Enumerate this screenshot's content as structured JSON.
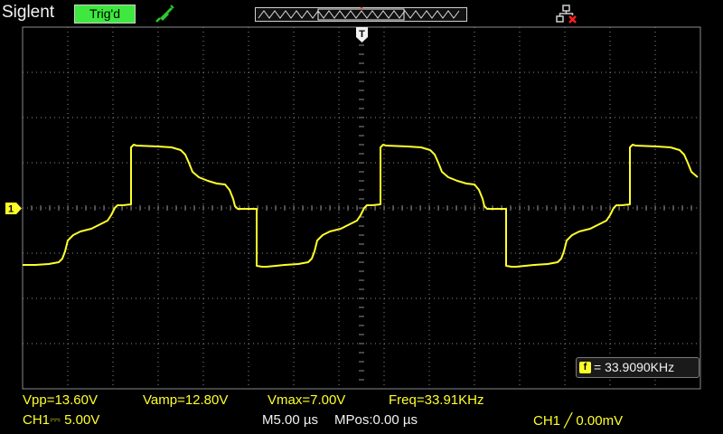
{
  "header": {
    "brand": "Siglent",
    "trigger_status": "Trig'd"
  },
  "icons": {
    "probe": "probe-icon",
    "network": "network-disconnected-icon",
    "trigger_marker": "trigger-position-icon",
    "channel_marker": "ch1-ground-marker-icon"
  },
  "colors": {
    "trace": "#ffff2a",
    "trigger_status_bg": "#3ee83e",
    "grid": "#8a8a8a"
  },
  "markers": {
    "trigger": "T",
    "channel": "1"
  },
  "freq_counter": {
    "icon_label": "f",
    "value": "= 33.9090KHz"
  },
  "measurements": {
    "vpp": "Vpp=13.60V",
    "vamp": "Vamp=12.80V",
    "vmax": "Vmax=7.00V",
    "freq": "Freq=33.91KHz"
  },
  "status": {
    "ch1_label": "CH1",
    "ch1_coupling": "⎓",
    "ch1_scale": "5.00V",
    "timebase": "M5.00 µs",
    "mpos": "MPos:0.00 µs",
    "trigger": "CH1 ╱ 0.00mV"
  }
}
